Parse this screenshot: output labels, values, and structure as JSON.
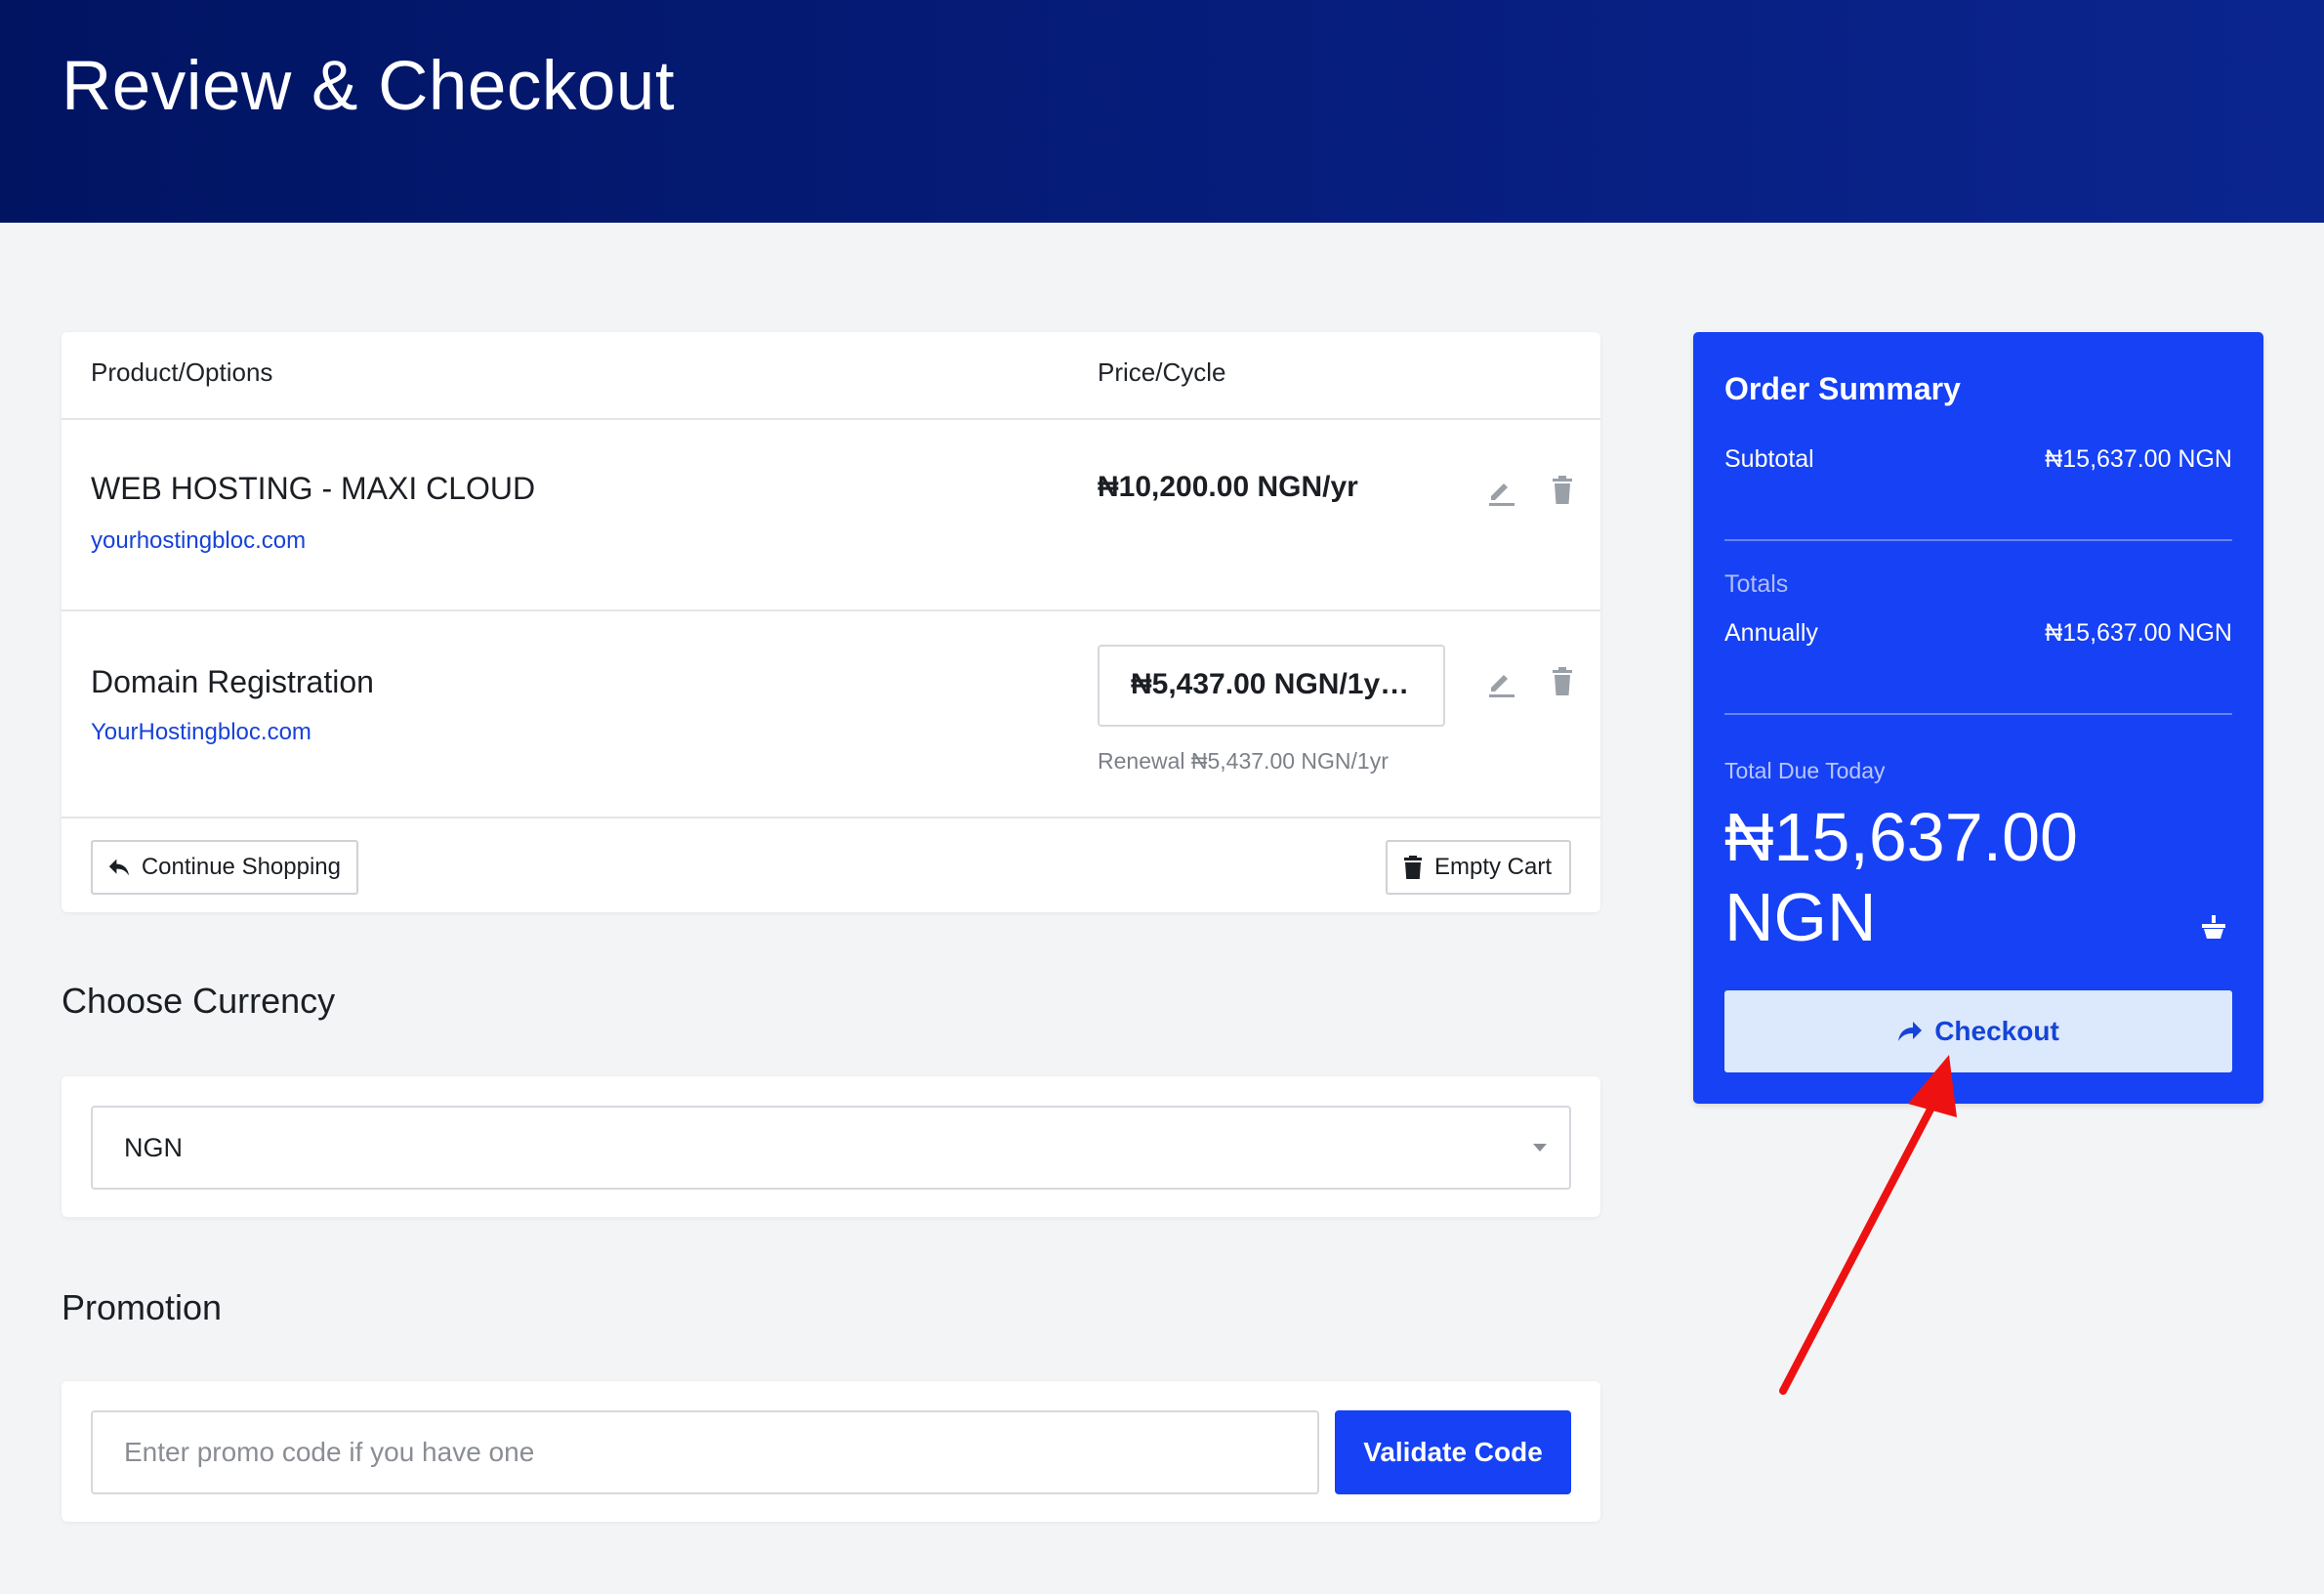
{
  "header": {
    "title": "Review & Checkout"
  },
  "cart": {
    "columns": {
      "product": "Product/Options",
      "price": "Price/Cycle"
    },
    "items": [
      {
        "name": "WEB HOSTING - MAXI CLOUD",
        "domain": "yourhostingbloc.com",
        "price": "₦10,200.00 NGN/yr"
      },
      {
        "name": "Domain Registration",
        "domain": "YourHostingbloc.com",
        "price": "₦5,437.00 NGN/1y…",
        "renewal": "Renewal ₦5,437.00 NGN/1yr"
      }
    ],
    "continue_label": "Continue Shopping",
    "empty_label": "Empty Cart"
  },
  "currency": {
    "title": "Choose Currency",
    "selected": "NGN"
  },
  "promotion": {
    "title": "Promotion",
    "placeholder": "Enter promo code if you have one",
    "validate_label": "Validate Code"
  },
  "summary": {
    "title": "Order Summary",
    "subtotal_label": "Subtotal",
    "subtotal_value": "₦15,637.00 NGN",
    "totals_label": "Totals",
    "annual_label": "Annually",
    "annual_value": "₦15,637.00 NGN",
    "due_label": "Total Due Today",
    "due_amount": "₦15,637.00 NGN",
    "checkout_label": "Checkout"
  },
  "icons": {
    "edit": "pencil-icon",
    "delete": "trash-icon",
    "back": "reply-arrow-icon",
    "empty": "trash-icon",
    "dropdown": "caret-down-icon",
    "basket": "basket-icon",
    "checkout": "share-arrow-icon"
  },
  "colors": {
    "header_start": "#011462",
    "header_end": "#0b258f",
    "accent": "#1641f5",
    "link": "#1742d8",
    "checkout_button_bg": "#dce8fb",
    "annotation_arrow": "#ee1111"
  }
}
